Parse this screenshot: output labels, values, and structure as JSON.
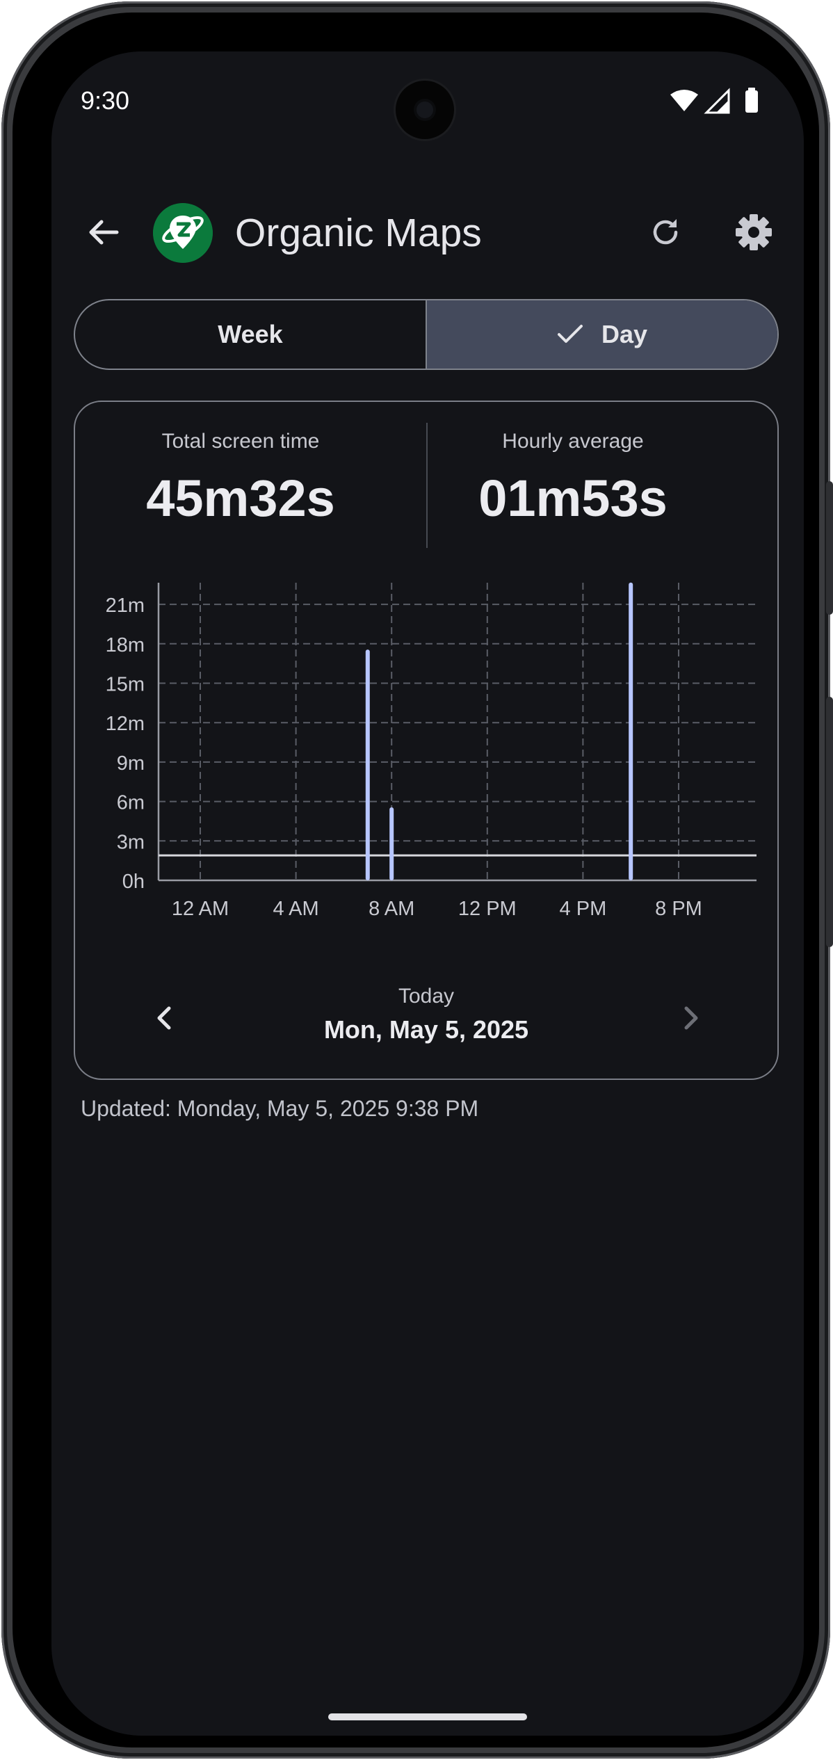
{
  "status_bar": {
    "time": "9:30"
  },
  "header": {
    "title": "Organic Maps"
  },
  "tabs": [
    {
      "label": "Week",
      "selected": false
    },
    {
      "label": "Day",
      "selected": true
    }
  ],
  "stats": {
    "total_label": "Total screen time",
    "total_value": "45m32s",
    "average_label": "Hourly average",
    "average_value": "01m53s"
  },
  "chart_data": {
    "type": "bar",
    "x_unit": "hour",
    "x_ticks": [
      "12 AM",
      "4 AM",
      "8 AM",
      "12 PM",
      "4 PM",
      "8 PM"
    ],
    "y_ticks": [
      "0h",
      "3m",
      "6m",
      "9m",
      "12m",
      "15m",
      "18m",
      "21m"
    ],
    "ylim": [
      0,
      23
    ],
    "bars": [
      {
        "hour": 7,
        "minutes": 17.4
      },
      {
        "hour": 8,
        "minutes": 5.4
      },
      {
        "hour": 18,
        "minutes": 22.5
      }
    ],
    "average_minutes": 1.9,
    "grid": true,
    "bar_color": "#b7c6ff"
  },
  "date_nav": {
    "label": "Today",
    "date": "Mon, May 5, 2025"
  },
  "updated_text": "Updated: Monday, May 5, 2025 9:38 PM",
  "icons": {
    "back": "arrow-left-icon",
    "refresh": "refresh-icon",
    "settings": "gear-icon",
    "prev": "chevron-left-icon",
    "next": "chevron-right-icon",
    "check": "check-icon",
    "wifi": "wifi-icon",
    "signal": "signal-icon",
    "battery": "battery-icon"
  },
  "colors": {
    "background": "#131418",
    "accent": "#b7c6ff",
    "selected_tab": "#444a5c",
    "app_icon": "#0b7a3c"
  }
}
